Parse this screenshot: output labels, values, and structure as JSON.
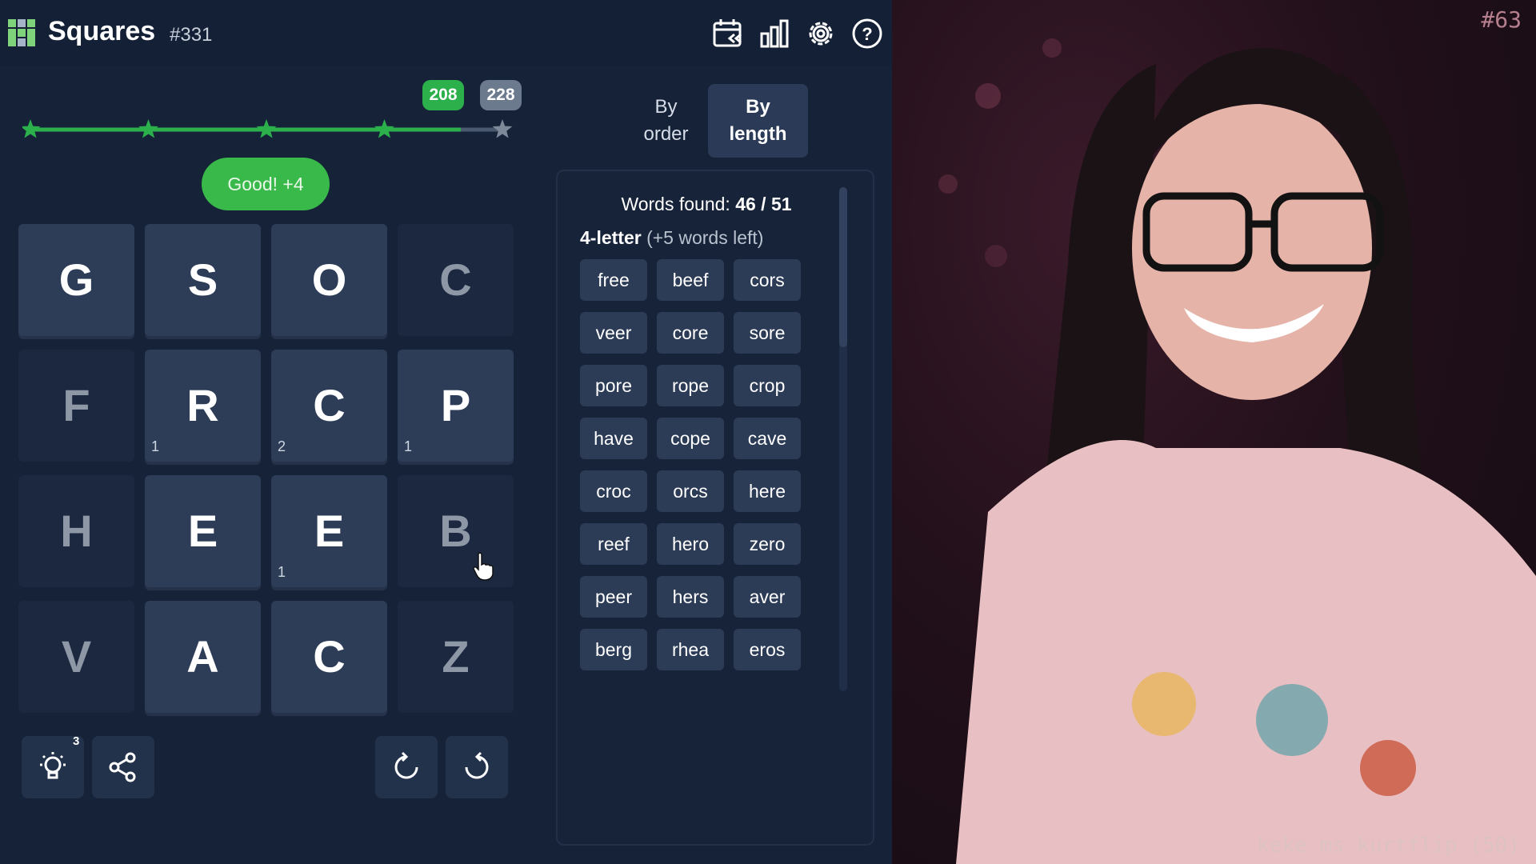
{
  "header": {
    "title": "Squares",
    "puzzle_number": "#331",
    "icons": [
      "calendar-back-icon",
      "stats-icon",
      "gear-icon",
      "help-icon"
    ]
  },
  "progress": {
    "current_score": "208",
    "max_score": "228",
    "fraction": 0.912,
    "stars_total": 5,
    "stars_reached": 4
  },
  "feedback": "Good! +4",
  "grid": {
    "rows": [
      [
        {
          "letter": "G",
          "active": true,
          "count": ""
        },
        {
          "letter": "S",
          "active": true,
          "count": ""
        },
        {
          "letter": "O",
          "active": true,
          "count": ""
        },
        {
          "letter": "C",
          "active": false,
          "count": ""
        }
      ],
      [
        {
          "letter": "F",
          "active": false,
          "count": ""
        },
        {
          "letter": "R",
          "active": true,
          "count": "1"
        },
        {
          "letter": "C",
          "active": true,
          "count": "2"
        },
        {
          "letter": "P",
          "active": true,
          "count": "1"
        }
      ],
      [
        {
          "letter": "H",
          "active": false,
          "count": ""
        },
        {
          "letter": "E",
          "active": true,
          "count": ""
        },
        {
          "letter": "E",
          "active": true,
          "count": "1"
        },
        {
          "letter": "B",
          "active": false,
          "count": ""
        }
      ],
      [
        {
          "letter": "V",
          "active": false,
          "count": ""
        },
        {
          "letter": "A",
          "active": true,
          "count": ""
        },
        {
          "letter": "C",
          "active": true,
          "count": ""
        },
        {
          "letter": "Z",
          "active": false,
          "count": ""
        }
      ]
    ]
  },
  "toolbar": {
    "hint_count": "3"
  },
  "sort": {
    "by_order": "By order",
    "by_length": "By length",
    "selected": "By length"
  },
  "word_panel": {
    "found_label": "Words found:",
    "found_value": "46 / 51",
    "section_title": "4-letter",
    "section_remaining": "(+5 words left)",
    "rows": [
      [
        "free",
        "beef",
        "cors"
      ],
      [
        "veer",
        "core",
        "sore"
      ],
      [
        "pore",
        "rope",
        "crop"
      ],
      [
        "have",
        "cope",
        "cave"
      ],
      [
        "croc",
        "orcs",
        "here"
      ],
      [
        "reef",
        "hero",
        "zero"
      ],
      [
        "peer",
        "hers",
        "aver"
      ],
      [
        "berg",
        "rhea",
        "eros"
      ]
    ]
  },
  "stream": {
    "overlay_tag": "#63",
    "chat_message": "keke ms kurtflip (50)"
  },
  "colors": {
    "accent_green": "#38b94a",
    "tile_active": "#2d3d58",
    "tile_inactive": "#1b2840",
    "background": "#162238"
  }
}
